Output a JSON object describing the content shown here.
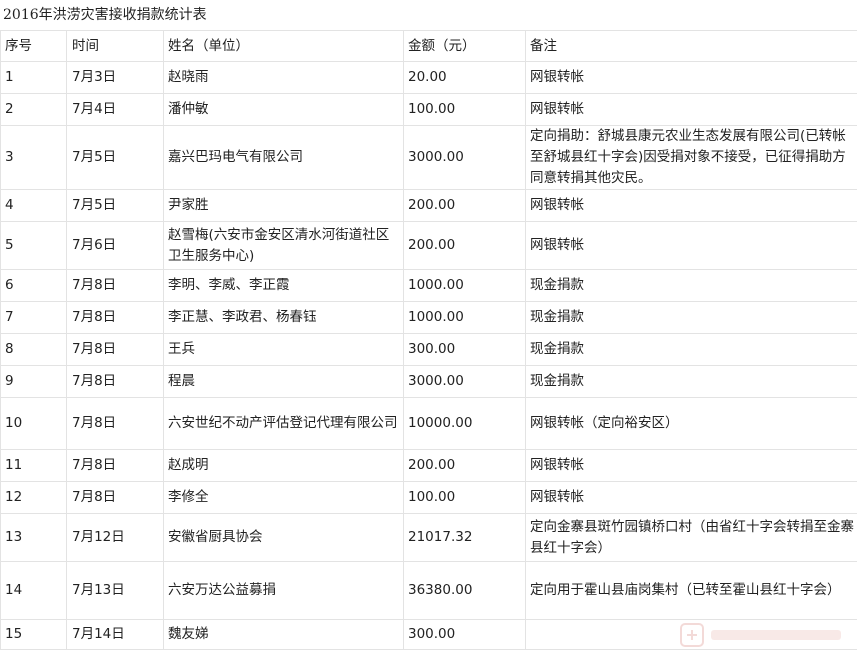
{
  "title": "2016年洪涝灾害接收捐款统计表",
  "columns": [
    "序号",
    "时间",
    "姓名（单位）",
    "金额（元）",
    "备注"
  ],
  "rows": [
    {
      "no": "1",
      "date": "7月3日",
      "name": "赵晓雨",
      "amount": "20.00",
      "note": "网银转帐"
    },
    {
      "no": "2",
      "date": "7月4日",
      "name": "潘仲敏",
      "amount": "100.00",
      "note": "网银转帐"
    },
    {
      "no": "3",
      "date": "7月5日",
      "name": "嘉兴巴玛电气有限公司",
      "amount": "3000.00",
      "note": "定向捐助：舒城县康元农业生态发展有限公司(已转帐至舒城县红十字会)因受捐对象不接受，已征得捐助方同意转捐其他灾民。"
    },
    {
      "no": "4",
      "date": "7月5日",
      "name": "尹家胜",
      "amount": "200.00",
      "note": "网银转帐"
    },
    {
      "no": "5",
      "date": "7月6日",
      "name": "赵雪梅(六安市金安区清水河街道社区卫生服务中心)",
      "amount": "200.00",
      "note": "网银转帐"
    },
    {
      "no": "6",
      "date": "7月8日",
      "name": "李明、李威、李正霞",
      "amount": "1000.00",
      "note": "现金捐款"
    },
    {
      "no": "7",
      "date": "7月8日",
      "name": "李正慧、李政君、杨春钰",
      "amount": "1000.00",
      "note": "现金捐款"
    },
    {
      "no": "8",
      "date": "7月8日",
      "name": "王兵",
      "amount": "300.00",
      "note": "现金捐款"
    },
    {
      "no": "9",
      "date": "7月8日",
      "name": "程晨",
      "amount": "3000.00",
      "note": "现金捐款"
    },
    {
      "no": "10",
      "date": "7月8日",
      "name": "六安世纪不动产评估登记代理有限公司",
      "amount": "10000.00",
      "note": "网银转帐（定向裕安区）"
    },
    {
      "no": "11",
      "date": "7月8日",
      "name": "赵成明",
      "amount": "200.00",
      "note": "网银转帐"
    },
    {
      "no": "12",
      "date": "7月8日",
      "name": "李修全",
      "amount": "100.00",
      "note": "网银转帐"
    },
    {
      "no": "13",
      "date": "7月12日",
      "name": "安徽省厨具协会",
      "amount": "21017.32",
      "note": "定向金寨县斑竹园镇桥口村（由省红十字会转捐至金寨县红十字会）"
    },
    {
      "no": "14",
      "date": "7月13日",
      "name": "六安万达公益募捐",
      "amount": "36380.00",
      "note": "定向用于霍山县庙岗集村（已转至霍山县红十字会）"
    },
    {
      "no": "15",
      "date": "7月14日",
      "name": "魏友娣",
      "amount": "300.00",
      "note": ""
    }
  ]
}
